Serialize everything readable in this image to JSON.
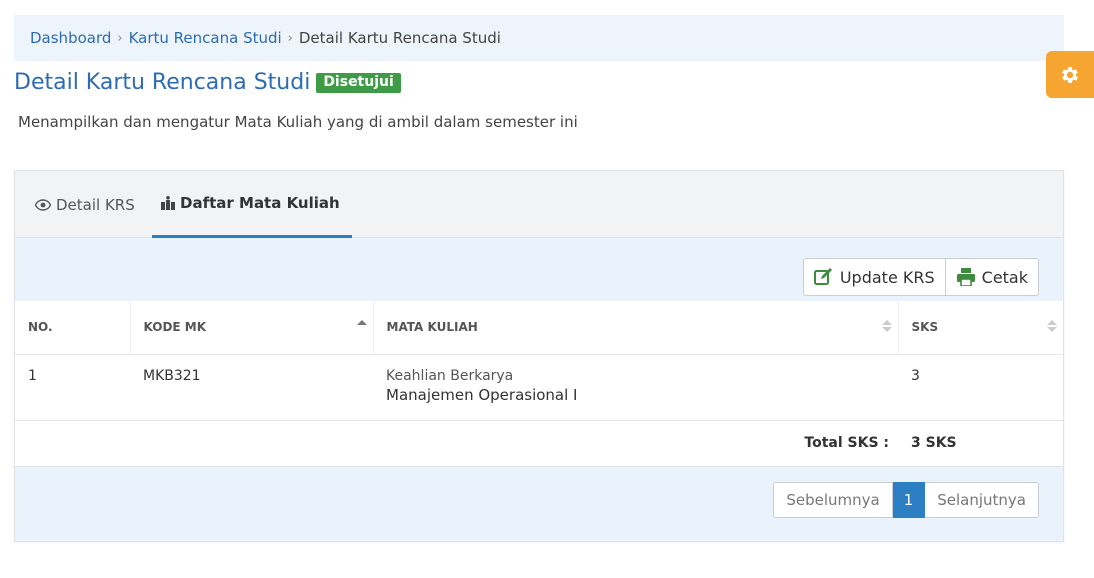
{
  "breadcrumb": {
    "items": [
      "Dashboard",
      "Kartu Rencana Studi"
    ],
    "current": "Detail Kartu Rencana Studi",
    "separator": "›"
  },
  "header": {
    "title": "Detail Kartu Rencana Studi",
    "status": "Disetujui",
    "subtitle": "Menampilkan dan mengatur Mata Kuliah yang di ambil dalam semester ini"
  },
  "tabs": [
    {
      "label": "Detail KRS",
      "icon": "eye-icon"
    },
    {
      "label": "Daftar Mata Kuliah",
      "icon": "books-icon",
      "active": true
    }
  ],
  "toolbar": {
    "update_label": "Update KRS",
    "print_label": "Cetak"
  },
  "table": {
    "columns": [
      "NO.",
      "KODE MK",
      "MATA KULIAH",
      "SKS"
    ],
    "rows": [
      {
        "no": "1",
        "kode": "MKB321",
        "group": "Keahlian Berkarya",
        "name": "Manajemen Operasional I",
        "sks": "3"
      }
    ],
    "total_label": "Total SKS :",
    "total_value": "3 SKS"
  },
  "pagination": {
    "prev": "Sebelumnya",
    "current": "1",
    "next": "Selanjutnya"
  },
  "colors": {
    "accent": "#2d7fc4",
    "title": "#2d6cb0",
    "status_badge": "#3d9c45",
    "settings_tab": "#f7a531",
    "icon_green": "#3d8b3d"
  }
}
